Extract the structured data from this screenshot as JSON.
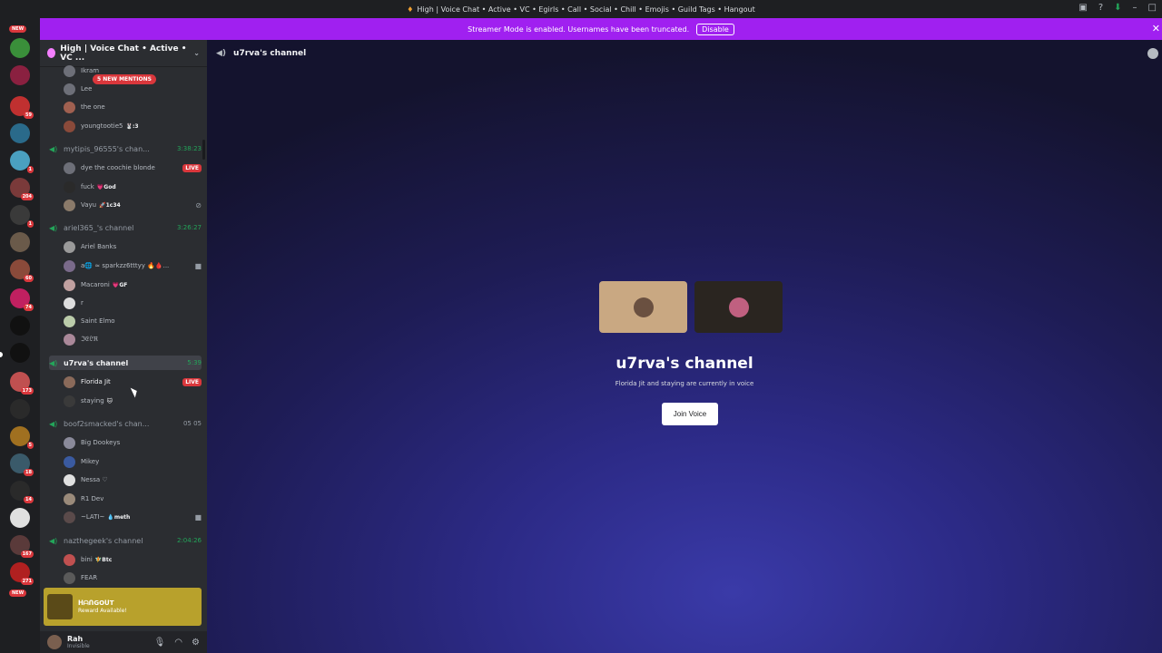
{
  "titlebar": {
    "title": "High | Voice Chat • Active • VC • Egirls • Call • Social • Chill • Emojis • Guild Tags • Hangout"
  },
  "streamer": {
    "text": "Streamer Mode is enabled. Usernames have been truncated.",
    "disable": "Disable"
  },
  "rail": {
    "new_top": "NEW",
    "new_bottom": "NEW",
    "badges": [
      "59",
      "1",
      "204",
      "1",
      "60",
      "74",
      "173",
      "5",
      "18",
      "14",
      "167",
      "271"
    ]
  },
  "guild": {
    "name": "High | Voice Chat • Active • VC ...",
    "mentions": "5 NEW MENTIONS"
  },
  "channels": [
    {
      "name": "mytipis_96555's chan...",
      "time": "3:38:23"
    },
    {
      "name": "ariel365_'s channel",
      "time": "3:26:27"
    },
    {
      "name": "u7rva's channel",
      "time": "5:39"
    },
    {
      "name": "boof2smacked's chan...",
      "time": "05  05"
    },
    {
      "name": "nazthegeek's channel",
      "time": "2:04:26"
    }
  ],
  "users": {
    "top": [
      {
        "name": "Ikram"
      },
      {
        "name": "Lee"
      },
      {
        "name": "the one"
      },
      {
        "name": "youngtootie5",
        "tag": "🐰:3"
      }
    ],
    "mytipis": [
      {
        "name": "dye the coochie blonde",
        "live": "LIVE"
      },
      {
        "name": "fuck",
        "tag": "💗God"
      },
      {
        "name": "Vayu",
        "tag": "🚀1c34"
      }
    ],
    "ariel": [
      {
        "name": "Ariel Banks"
      },
      {
        "name": "a🌐 ≈ sparkzz6tttyy 🔥🩸..."
      },
      {
        "name": "Macaroni",
        "tag": "💗GF"
      },
      {
        "name": "r"
      },
      {
        "name": "Saint Elmo"
      },
      {
        "name": "ℑ𝔈𝔏ℜ"
      }
    ],
    "u7rva": [
      {
        "name": "Florida Jit",
        "live": "LIVE"
      },
      {
        "name": "staying",
        "tag": "🐱"
      }
    ],
    "boof": [
      {
        "name": "Big Dookeys"
      },
      {
        "name": "Mikey"
      },
      {
        "name": "Nessa ♡"
      },
      {
        "name": "R1 Dev"
      },
      {
        "name": "~LATI~",
        "tag": "💧meth"
      }
    ],
    "naz": [
      {
        "name": "bini",
        "tag": "🧚Btc"
      },
      {
        "name": "FEAR"
      }
    ]
  },
  "quest": {
    "title": "ᕼᗩᑎGOᑌT",
    "subtitle": "Reward Available!"
  },
  "me": {
    "name": "Rah",
    "status": "Invisible"
  },
  "main": {
    "header": "u7rva's channel",
    "title": "u7rva's channel",
    "subtitle": "Florida Jit and staying are currently in voice",
    "join": "Join Voice"
  }
}
